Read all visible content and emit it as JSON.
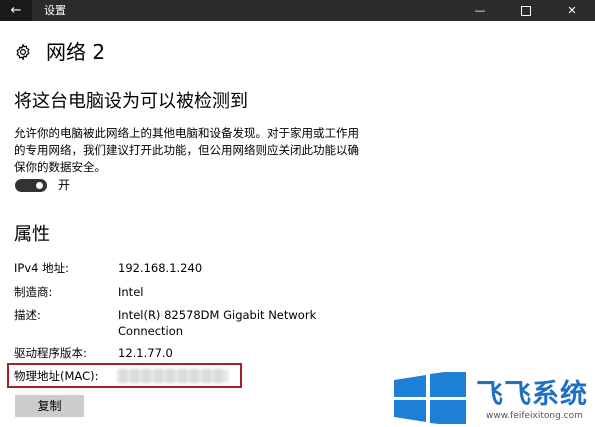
{
  "window": {
    "title": "设置",
    "back_icon": "←",
    "min_icon": "—",
    "close_icon": "✕"
  },
  "page": {
    "title": "网络 2"
  },
  "discoverable": {
    "heading": "将这台电脑设为可以被检测到",
    "description": "允许你的电脑被此网络上的其他电脑和设备发现。对于家用或工作用的专用网络，我们建议打开此功能，但公用网络则应关闭此功能以确保你的数据安全。",
    "toggle_state": "开"
  },
  "properties": {
    "heading": "属性",
    "rows": [
      {
        "label": "IPv4 地址:",
        "value": "192.168.1.240"
      },
      {
        "label": "制造商:",
        "value": "Intel"
      },
      {
        "label": "描述:",
        "value": "Intel(R) 82578DM Gigabit Network Connection"
      },
      {
        "label": "驱动程序版本:",
        "value": "12.1.77.0"
      },
      {
        "label": "物理地址(MAC):",
        "value": ""
      }
    ],
    "copy_label": "复制"
  },
  "watermark": {
    "brand": "飞飞系统",
    "url": "www.feifeixitong.com"
  },
  "colors": {
    "titlebar": "#2b2b2b",
    "highlight_border": "#a3212b",
    "logo_blue": "#1f6fc4"
  }
}
